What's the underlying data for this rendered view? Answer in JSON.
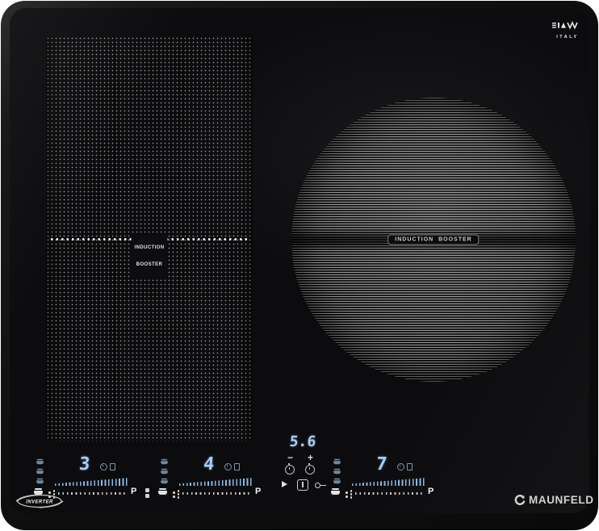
{
  "brand": {
    "name": "MAUNFELD",
    "inverter_badge": "INVERTER",
    "made_in": "ITALY"
  },
  "zones": {
    "flex_left": {
      "label_line1": "INDUCTION",
      "label_line2": "BOOSTER"
    },
    "circle_right": {
      "label": "INDUCTION  BOOSTER"
    }
  },
  "controls": {
    "zone1": {
      "level": "3",
      "boost": "P"
    },
    "zone2": {
      "level": "4",
      "boost": "P"
    },
    "zone3": {
      "level": "7",
      "boost": "P"
    },
    "timer": {
      "value": "5.6",
      "minus": "−",
      "plus": "+"
    }
  },
  "colors": {
    "display_blue": "#a9cdf1",
    "slider_blue": "#86b8e8",
    "panel_white": "#e6e6e6",
    "glass_black": "#0c0c0e"
  }
}
